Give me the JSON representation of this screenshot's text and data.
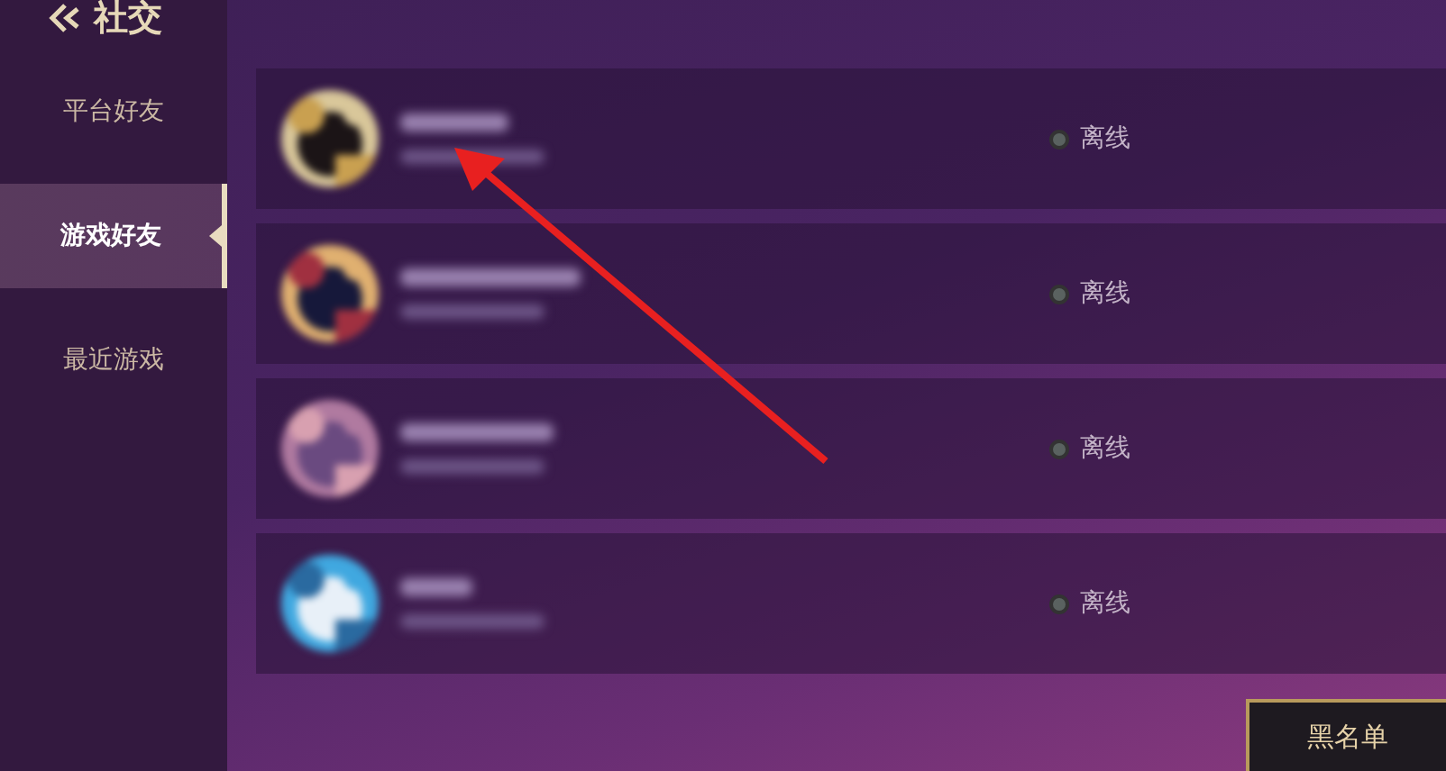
{
  "header": {
    "title": "社交"
  },
  "sidebar": {
    "items": [
      {
        "label": "平台好友",
        "selected": false
      },
      {
        "label": "游戏好友",
        "selected": true
      },
      {
        "label": "最近游戏",
        "selected": false
      }
    ]
  },
  "friends": [
    {
      "status": "离线",
      "online": false
    },
    {
      "status": "离线",
      "online": false
    },
    {
      "status": "离线",
      "online": false
    },
    {
      "status": "离线",
      "online": false
    }
  ],
  "buttons": [
    {
      "label": "黑名单"
    }
  ]
}
